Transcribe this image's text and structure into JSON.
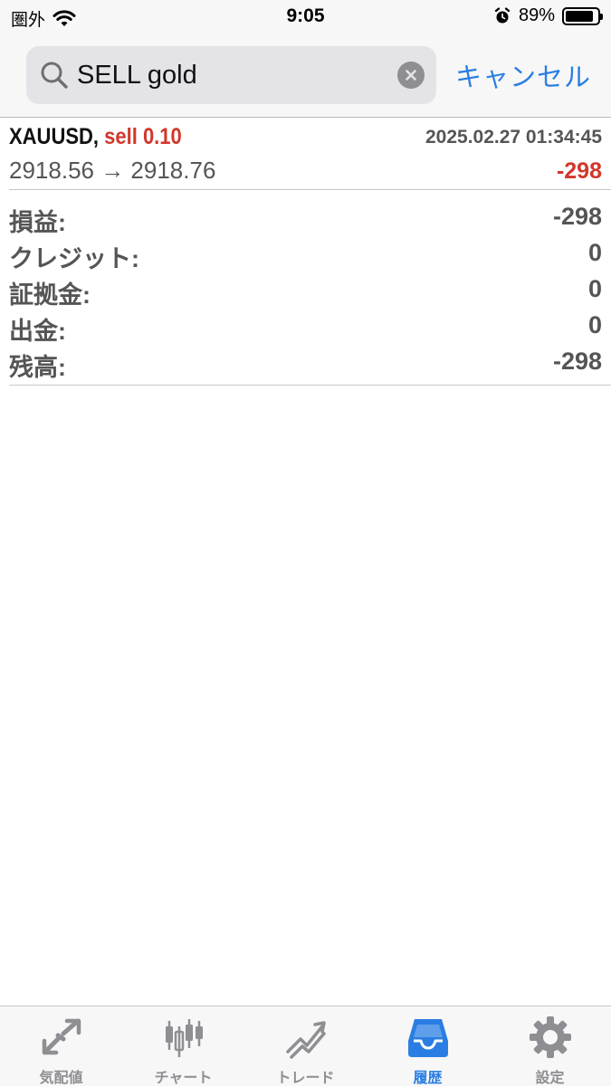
{
  "status_bar": {
    "carrier": "圏外",
    "time": "9:05",
    "battery": "89%",
    "battery_level": 0.89
  },
  "search": {
    "query": "SELL gold",
    "cancel_label": "キャンセル"
  },
  "deal": {
    "symbol": "XAUUSD,",
    "type": "sell 0.10",
    "time": "2025.02.27 01:34:45",
    "prices": "2918.56 → 2918.76",
    "profit": "-298"
  },
  "summary": [
    {
      "label": "損益:",
      "value": "-298"
    },
    {
      "label": "クレジット:",
      "value": "0"
    },
    {
      "label": "証拠金:",
      "value": "0"
    },
    {
      "label": "出金:",
      "value": "0"
    },
    {
      "label": "残高:",
      "value": "-298"
    }
  ],
  "tabs": [
    {
      "label": "気配値",
      "icon": "quotes-icon"
    },
    {
      "label": "チャート",
      "icon": "chart-icon"
    },
    {
      "label": "トレード",
      "icon": "trade-icon"
    },
    {
      "label": "履歴",
      "icon": "history-icon",
      "active": true
    },
    {
      "label": "設定",
      "icon": "settings-icon"
    }
  ],
  "colors": {
    "accent": "#2a7ee3",
    "loss": "#d1372b",
    "muted": "#8e8e93"
  }
}
